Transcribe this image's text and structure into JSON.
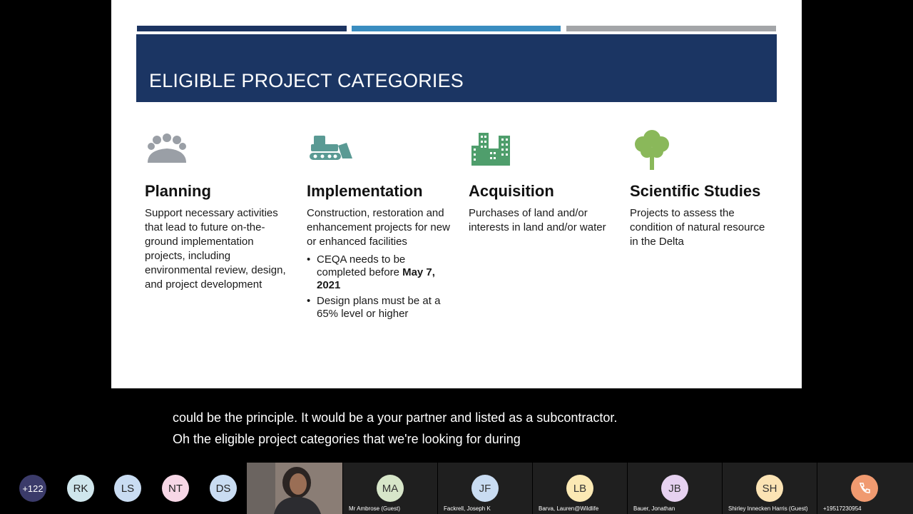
{
  "slide": {
    "title": "ELIGIBLE PROJECT CATEGORIES",
    "columns": [
      {
        "icon": "people-meeting-icon",
        "heading": "Planning",
        "body": "Support necessary activities that lead to future on-the-ground implementation projects, including environmental review, design, and project development"
      },
      {
        "icon": "bulldozer-icon",
        "heading": "Implementation",
        "body": "Construction, restoration and enhancement projects for new or enhanced facilities",
        "bullets": [
          {
            "pre": "CEQA needs to be completed before ",
            "bold": "May 7, 2021"
          },
          {
            "pre": "Design plans must be at a 65% level or higher",
            "bold": ""
          }
        ]
      },
      {
        "icon": "buildings-icon",
        "heading": "Acquisition",
        "body": "Purchases of land and/or interests in land and/or water"
      },
      {
        "icon": "tree-icon",
        "heading": "Scientific Studies",
        "body": "Projects to assess the condition of natural resource in the Delta"
      }
    ]
  },
  "captions": {
    "line1": "could be the principle. It would be a your partner and listed as a subcontractor.",
    "line2": "Oh the eligible project categories that we're looking for during"
  },
  "participants": {
    "overflow": "+122",
    "avatars": [
      "RK",
      "LS",
      "NT",
      "DS"
    ],
    "tiles": [
      {
        "initials": "MA",
        "name": "Mr Ambrose (Guest)"
      },
      {
        "initials": "JF",
        "name": "Fackrell, Joseph K"
      },
      {
        "initials": "LB",
        "name": "Barva, Lauren@Wildlife"
      },
      {
        "initials": "JB",
        "name": "Bauer, Jonathan"
      },
      {
        "initials": "SH",
        "name": "Shirley Innecken Harris (Guest)"
      },
      {
        "initials": "",
        "name": "+19517230954"
      }
    ]
  },
  "colors": {
    "banner": "#1b3563",
    "icon_gray": "#9a9fa6",
    "icon_teal": "#5a9a94",
    "icon_green": "#4f9e6c",
    "icon_tree": "#8ab85a"
  }
}
